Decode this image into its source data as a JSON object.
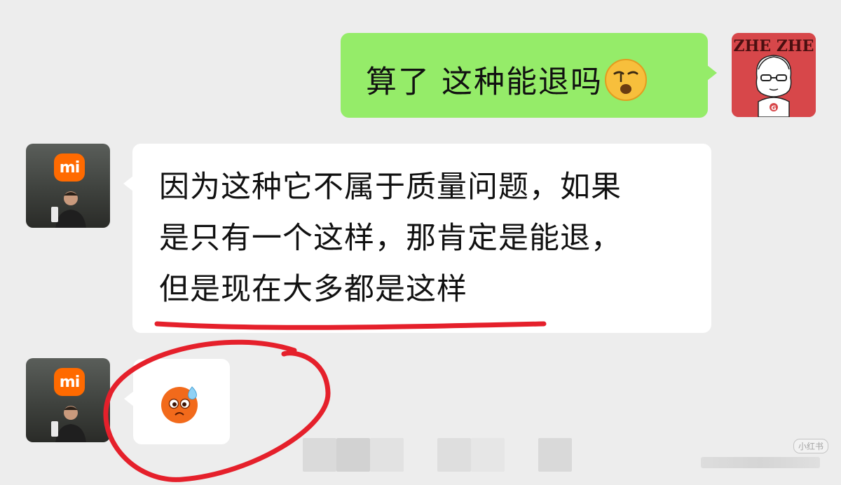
{
  "avatars": {
    "me": {
      "caption": "ZHE ZHE",
      "initial": "G"
    },
    "shop": {
      "logo": "mi"
    }
  },
  "messages": [
    {
      "side": "right",
      "text": "算了  这种能退吗",
      "emoji": "sleepy-face-emoji"
    },
    {
      "side": "left",
      "lines": [
        "因为这种它不属于质量问题，如果",
        "是只有一个这样，那肯定是能退，",
        "但是现在大多都是这样"
      ]
    },
    {
      "side": "left",
      "emoji": "anxious-sweat-face-emoji"
    }
  ],
  "watermark": "小红书",
  "annotations": {
    "underline_color": "#e5202b",
    "circle_color": "#e5202b"
  },
  "colors": {
    "background": "#ededed",
    "sent_bubble": "#95ec69",
    "received_bubble": "#ffffff",
    "mi_orange": "#ff6a00"
  }
}
